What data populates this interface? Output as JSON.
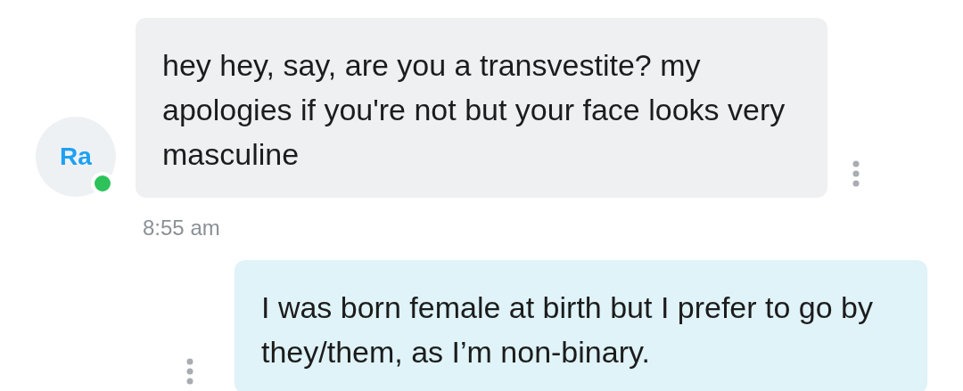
{
  "messages": [
    {
      "kind": "incoming",
      "avatar": {
        "initials": "Ra",
        "online": true
      },
      "text": "hey hey, say, are you a transvestite? my apologies if you're not but your face looks very masculine",
      "time": "8:55 am"
    },
    {
      "kind": "outgoing",
      "text": "I was born female at birth but I prefer to go by they/them, as I’m non-binary."
    }
  ]
}
